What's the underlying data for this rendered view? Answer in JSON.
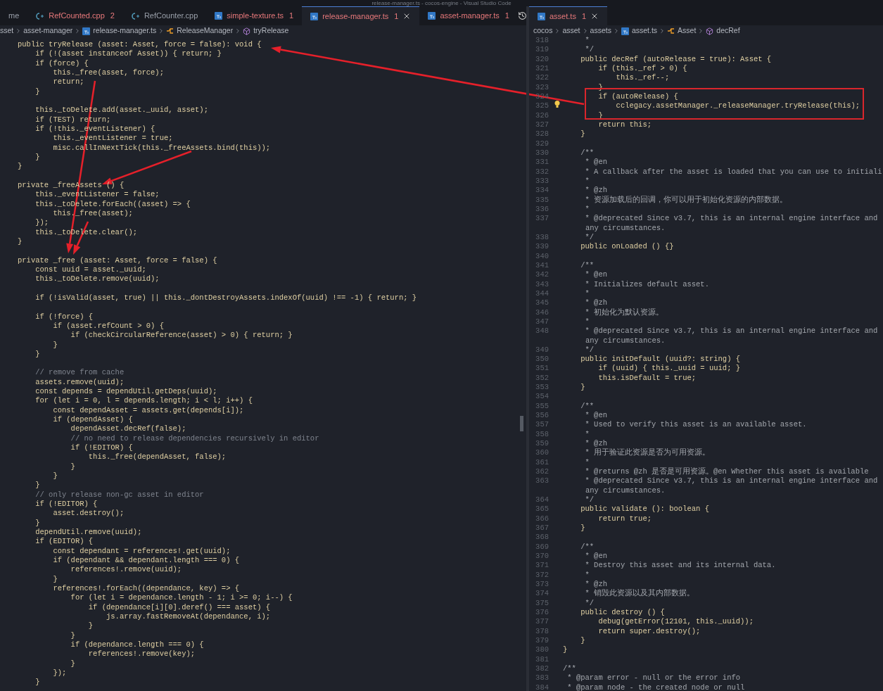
{
  "window": {
    "title": "release-manager.ts - cocos-engine - Visual Studio Code"
  },
  "left_editor": {
    "tabs": [
      {
        "label": "me",
        "kind": "none",
        "selected": false
      },
      {
        "label": "RefCounted.cpp",
        "kind": "cpp",
        "problems": "2",
        "selected": false
      },
      {
        "label": "RefCounter.cpp",
        "kind": "cpp",
        "selected": false
      },
      {
        "label": "simple-texture.ts",
        "kind": "ts",
        "problems": "1",
        "selected": false
      },
      {
        "label": "release-manager.ts",
        "kind": "ts",
        "problems": "1",
        "selected": true
      },
      {
        "label": "asset-manager.ts",
        "kind": "ts",
        "problems": "1",
        "selected": false
      }
    ],
    "breadcrumbs": [
      {
        "label": "sset",
        "kind": "folder"
      },
      {
        "label": "asset-manager",
        "kind": "folder"
      },
      {
        "label": "release-manager.ts",
        "kind": "ts"
      },
      {
        "label": "ReleaseManager",
        "kind": "class"
      },
      {
        "label": "tryRelease",
        "kind": "method"
      }
    ],
    "lines": [
      {
        "text": "public tryRelease (asset: Asset, force = false): void {",
        "kind": "code"
      },
      {
        "text": "    if (!(asset instanceof Asset)) { return; }",
        "kind": "code"
      },
      {
        "text": "    if (force) {",
        "kind": "code"
      },
      {
        "text": "        this._free(asset, force);",
        "kind": "code"
      },
      {
        "text": "        return;",
        "kind": "code"
      },
      {
        "text": "    }",
        "kind": "code"
      },
      {
        "kind": "blank"
      },
      {
        "text": "    this._toDelete.add(asset._uuid, asset);",
        "kind": "code"
      },
      {
        "text": "    if (TEST) return;",
        "kind": "code"
      },
      {
        "text": "    if (!this._eventListener) {",
        "kind": "code"
      },
      {
        "text": "        this._eventListener = true;",
        "kind": "code"
      },
      {
        "text": "        misc.callInNextTick(this._freeAssets.bind(this));",
        "kind": "code"
      },
      {
        "text": "    }",
        "kind": "code"
      },
      {
        "text": "}",
        "kind": "code"
      },
      {
        "kind": "blank"
      },
      {
        "text": "private _freeAssets () {",
        "kind": "code"
      },
      {
        "text": "    this._eventListener = false;",
        "kind": "code"
      },
      {
        "text": "    this._toDelete.forEach((asset) => {",
        "kind": "code"
      },
      {
        "text": "        this._free(asset);",
        "kind": "code"
      },
      {
        "text": "    });",
        "kind": "code"
      },
      {
        "text": "    this._toDelete.clear();",
        "kind": "code"
      },
      {
        "text": "}",
        "kind": "code"
      },
      {
        "kind": "blank"
      },
      {
        "text": "private _free (asset: Asset, force = false) {",
        "kind": "code"
      },
      {
        "text": "    const uuid = asset._uuid;",
        "kind": "code"
      },
      {
        "text": "    this._toDelete.remove(uuid);",
        "kind": "code"
      },
      {
        "kind": "blank"
      },
      {
        "text": "    if (!isValid(asset, true) || this._dontDestroyAssets.indexOf(uuid) !== -1) { return; }",
        "kind": "code"
      },
      {
        "kind": "blank"
      },
      {
        "text": "    if (!force) {",
        "kind": "code"
      },
      {
        "text": "        if (asset.refCount > 0) {",
        "kind": "code"
      },
      {
        "text": "            if (checkCircularReference(asset) > 0) { return; }",
        "kind": "code"
      },
      {
        "text": "        }",
        "kind": "code"
      },
      {
        "text": "    }",
        "kind": "code"
      },
      {
        "kind": "blank"
      },
      {
        "text": "    // remove from cache",
        "kind": "comment"
      },
      {
        "text": "    assets.remove(uuid);",
        "kind": "code"
      },
      {
        "text": "    const depends = dependUtil.getDeps(uuid);",
        "kind": "code"
      },
      {
        "text": "    for (let i = 0, l = depends.length; i < l; i++) {",
        "kind": "code"
      },
      {
        "text": "        const dependAsset = assets.get(depends[i]);",
        "kind": "code"
      },
      {
        "text": "        if (dependAsset) {",
        "kind": "code"
      },
      {
        "text": "            dependAsset.decRef(false);",
        "kind": "code"
      },
      {
        "text": "            // no need to release dependencies recursively in editor",
        "kind": "comment"
      },
      {
        "text": "            if (!EDITOR) {",
        "kind": "code"
      },
      {
        "text": "                this._free(dependAsset, false);",
        "kind": "code"
      },
      {
        "text": "            }",
        "kind": "code"
      },
      {
        "text": "        }",
        "kind": "code"
      },
      {
        "text": "    }",
        "kind": "code"
      },
      {
        "text": "    // only release non-gc asset in editor",
        "kind": "comment"
      },
      {
        "text": "    if (!EDITOR) {",
        "kind": "code"
      },
      {
        "text": "        asset.destroy();",
        "kind": "code"
      },
      {
        "text": "    }",
        "kind": "code"
      },
      {
        "text": "    dependUtil.remove(uuid);",
        "kind": "code"
      },
      {
        "text": "    if (EDITOR) {",
        "kind": "code"
      },
      {
        "text": "        const dependant = references!.get(uuid);",
        "kind": "code"
      },
      {
        "text": "        if (dependant && dependant.length === 0) {",
        "kind": "code"
      },
      {
        "text": "            references!.remove(uuid);",
        "kind": "code"
      },
      {
        "text": "        }",
        "kind": "code"
      },
      {
        "text": "        references!.forEach((dependance, key) => {",
        "kind": "code"
      },
      {
        "text": "            for (let i = dependance.length - 1; i >= 0; i--) {",
        "kind": "code"
      },
      {
        "text": "                if (dependance[i][0].deref() === asset) {",
        "kind": "code"
      },
      {
        "text": "                    js.array.fastRemoveAt(dependance, i);",
        "kind": "code"
      },
      {
        "text": "                }",
        "kind": "code"
      },
      {
        "text": "            }",
        "kind": "code"
      },
      {
        "text": "            if (dependance.length === 0) {",
        "kind": "code"
      },
      {
        "text": "                references!.remove(key);",
        "kind": "code"
      },
      {
        "text": "            }",
        "kind": "code"
      },
      {
        "text": "        });",
        "kind": "code"
      },
      {
        "text": "    }",
        "kind": "code"
      }
    ]
  },
  "right_editor": {
    "tabs": [
      {
        "label": "asset.ts",
        "kind": "ts",
        "problems": "1",
        "selected": true
      }
    ],
    "breadcrumbs": [
      {
        "label": "cocos",
        "kind": "folder"
      },
      {
        "label": "asset",
        "kind": "folder"
      },
      {
        "label": "assets",
        "kind": "folder"
      },
      {
        "label": "asset.ts",
        "kind": "ts"
      },
      {
        "label": "Asset",
        "kind": "class"
      },
      {
        "label": "decRef",
        "kind": "method"
      }
    ],
    "lines": [
      {
        "number": "318",
        "text": "     *",
        "kind": "doc"
      },
      {
        "number": "319",
        "text": "     */",
        "kind": "doc"
      },
      {
        "number": "320",
        "text": "    public decRef (autoRelease = true): Asset {",
        "kind": "code"
      },
      {
        "number": "321",
        "text": "        if (this._ref > 0) {",
        "kind": "code"
      },
      {
        "number": "322",
        "text": "            this._ref--;",
        "kind": "code"
      },
      {
        "number": "323",
        "text": "        }",
        "kind": "code"
      },
      {
        "number": "324",
        "text": "        if (autoRelease) {",
        "kind": "code"
      },
      {
        "number": "325",
        "text": "            cclegacy.assetManager._releaseManager.tryRelease(this);",
        "kind": "code"
      },
      {
        "number": "326",
        "text": "        }",
        "kind": "code"
      },
      {
        "number": "327",
        "text": "        return this;",
        "kind": "code"
      },
      {
        "number": "328",
        "text": "    }",
        "kind": "code"
      },
      {
        "number": "329",
        "kind": "blank"
      },
      {
        "number": "330",
        "text": "    /**",
        "kind": "doc"
      },
      {
        "number": "331",
        "text": "     * @en",
        "kind": "doc"
      },
      {
        "number": "332",
        "text": "     * A callback after the asset is loaded that you can use to initiali",
        "kind": "doc"
      },
      {
        "number": "333",
        "text": "     *",
        "kind": "doc"
      },
      {
        "number": "334",
        "text": "     * @zh",
        "kind": "doc"
      },
      {
        "number": "335",
        "text": "     * 资源加载后的回调，你可以用于初始化资源的内部数据。",
        "kind": "doc"
      },
      {
        "number": "336",
        "text": "     *",
        "kind": "doc"
      },
      {
        "number": "337",
        "text": "     * @deprecated Since v3.7, this is an internal engine interface and",
        "kind": "doc",
        "wrap": "any circumstances."
      },
      {
        "number": "338",
        "text": "     */",
        "kind": "doc"
      },
      {
        "number": "339",
        "text": "    public onLoaded () {}",
        "kind": "code"
      },
      {
        "number": "340",
        "kind": "blank"
      },
      {
        "number": "341",
        "text": "    /**",
        "kind": "doc"
      },
      {
        "number": "342",
        "text": "     * @en",
        "kind": "doc"
      },
      {
        "number": "343",
        "text": "     * Initializes default asset.",
        "kind": "doc"
      },
      {
        "number": "344",
        "text": "     *",
        "kind": "doc"
      },
      {
        "number": "345",
        "text": "     * @zh",
        "kind": "doc"
      },
      {
        "number": "346",
        "text": "     * 初始化为默认资源。",
        "kind": "doc"
      },
      {
        "number": "347",
        "text": "     *",
        "kind": "doc"
      },
      {
        "number": "348",
        "text": "     * @deprecated Since v3.7, this is an internal engine interface and",
        "kind": "doc",
        "wrap": "any circumstances."
      },
      {
        "number": "349",
        "text": "     */",
        "kind": "doc"
      },
      {
        "number": "350",
        "text": "    public initDefault (uuid?: string) {",
        "kind": "code"
      },
      {
        "number": "351",
        "text": "        if (uuid) { this._uuid = uuid; }",
        "kind": "code"
      },
      {
        "number": "352",
        "text": "        this.isDefault = true;",
        "kind": "code"
      },
      {
        "number": "353",
        "text": "    }",
        "kind": "code"
      },
      {
        "number": "354",
        "kind": "blank"
      },
      {
        "number": "355",
        "text": "    /**",
        "kind": "doc"
      },
      {
        "number": "356",
        "text": "     * @en",
        "kind": "doc"
      },
      {
        "number": "357",
        "text": "     * Used to verify this asset is an available asset.",
        "kind": "doc"
      },
      {
        "number": "358",
        "text": "     *",
        "kind": "doc"
      },
      {
        "number": "359",
        "text": "     * @zh",
        "kind": "doc"
      },
      {
        "number": "360",
        "text": "     * 用于验证此资源是否为可用资源。",
        "kind": "doc"
      },
      {
        "number": "361",
        "text": "     *",
        "kind": "doc"
      },
      {
        "number": "362",
        "text": "     * @returns @zh 是否是可用资源。@en Whether this asset is available",
        "kind": "doc"
      },
      {
        "number": "363",
        "text": "     * @deprecated Since v3.7, this is an internal engine interface and",
        "kind": "doc",
        "wrap": "any circumstances."
      },
      {
        "number": "364",
        "text": "     */",
        "kind": "doc"
      },
      {
        "number": "365",
        "text": "    public validate (): boolean {",
        "kind": "code"
      },
      {
        "number": "366",
        "text": "        return true;",
        "kind": "code"
      },
      {
        "number": "367",
        "text": "    }",
        "kind": "code"
      },
      {
        "number": "368",
        "kind": "blank"
      },
      {
        "number": "369",
        "text": "    /**",
        "kind": "doc"
      },
      {
        "number": "370",
        "text": "     * @en",
        "kind": "doc"
      },
      {
        "number": "371",
        "text": "     * Destroy this asset and its internal data.",
        "kind": "doc"
      },
      {
        "number": "372",
        "text": "     *",
        "kind": "doc"
      },
      {
        "number": "373",
        "text": "     * @zh",
        "kind": "doc"
      },
      {
        "number": "374",
        "text": "     * 销毁此资源以及其内部数据。",
        "kind": "doc"
      },
      {
        "number": "375",
        "text": "     */",
        "kind": "doc"
      },
      {
        "number": "376",
        "text": "    public destroy () {",
        "kind": "code"
      },
      {
        "number": "377",
        "text": "        debug(getError(12101, this._uuid));",
        "kind": "code"
      },
      {
        "number": "378",
        "text": "        return super.destroy();",
        "kind": "code"
      },
      {
        "number": "379",
        "text": "    }",
        "kind": "code"
      },
      {
        "number": "380",
        "text": "}",
        "kind": "code"
      },
      {
        "number": "381",
        "kind": "blank"
      },
      {
        "number": "382",
        "text": "/**",
        "kind": "doc"
      },
      {
        "number": "383",
        "text": " * @param error - null or the error info",
        "kind": "doc"
      },
      {
        "number": "384",
        "text": " * @param node - the created node or null",
        "kind": "doc"
      }
    ]
  }
}
